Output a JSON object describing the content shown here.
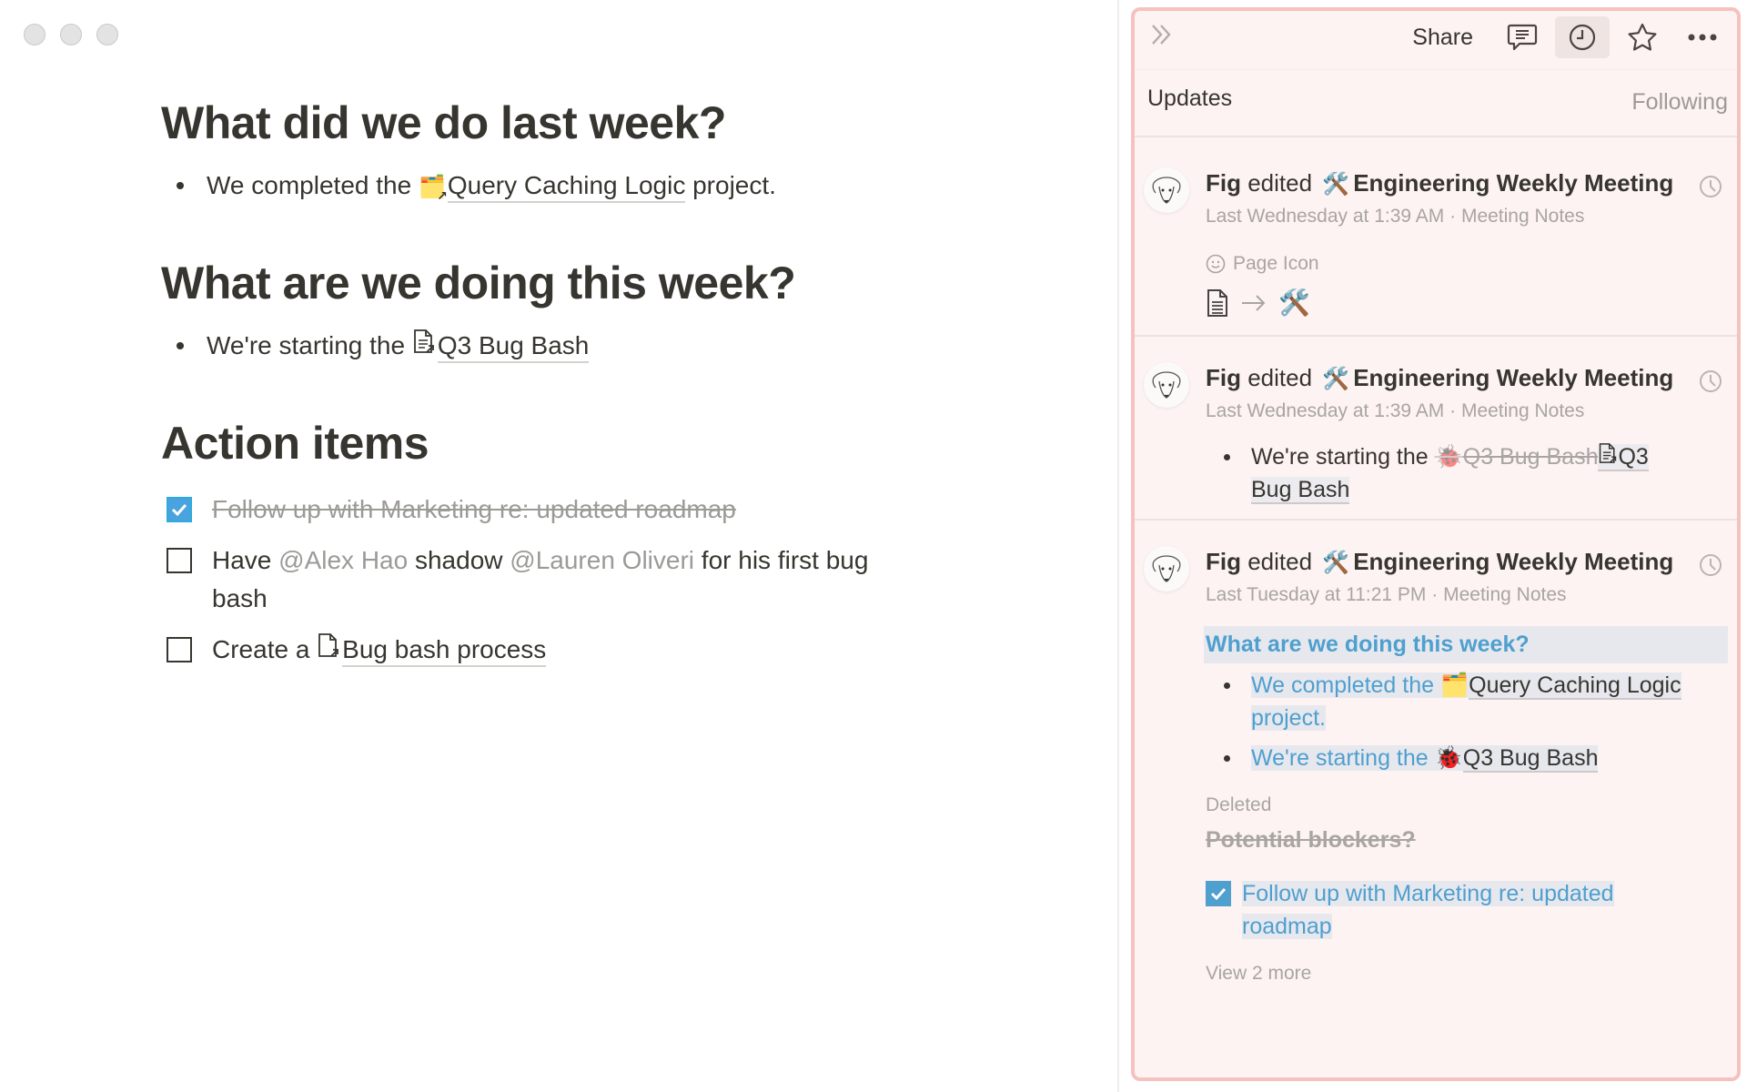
{
  "window": {
    "controls": [
      "close",
      "minimize",
      "zoom"
    ]
  },
  "document": {
    "sections": [
      {
        "heading": "What did we do last week?",
        "bullets": [
          {
            "prefix": "We completed the ",
            "link_icon": "card-index-dividers-icon",
            "link_text": "Query Caching Logic",
            "suffix": " project."
          }
        ]
      },
      {
        "heading": "What are we doing this week?",
        "bullets": [
          {
            "prefix": "We're starting the ",
            "link_icon": "page-icon",
            "link_text": "Q3 Bug Bash",
            "suffix": ""
          }
        ]
      },
      {
        "heading": "Action items",
        "todos": [
          {
            "checked": true,
            "text": "Follow up with Marketing re: updated roadmap"
          },
          {
            "checked": false,
            "parts": [
              "Have ",
              "@Alex Hao",
              " shadow ",
              "@Lauren Oliveri",
              " for his first bug bash"
            ]
          },
          {
            "checked": false,
            "prefix": "Create a ",
            "link_icon": "blank-page-icon",
            "link_text": "Bug bash process"
          }
        ]
      }
    ]
  },
  "panel": {
    "topbar": {
      "collapse_icon": "double-chevron-right-icon",
      "share_label": "Share",
      "icons": [
        "comments-icon",
        "updates-clock-icon",
        "favorite-star-icon",
        "more-icon"
      ],
      "active_icon": "updates-clock-icon"
    },
    "title": "Updates",
    "filter_label": "Following",
    "accent_border": "#f5c2c0",
    "background": "#fdf3f2",
    "updates": [
      {
        "actor": "Fig",
        "verb": " edited ",
        "page_emoji": "🛠️",
        "page": "Engineering Weekly Meeting",
        "time": "Last Wednesday at 1:39 AM",
        "separator": " · ",
        "location": "Meeting Notes",
        "change": {
          "type": "page_icon",
          "label": "Page Icon",
          "from": "document-icon",
          "arrow": "→",
          "to": "🛠️"
        }
      },
      {
        "actor": "Fig",
        "verb": " edited ",
        "page_emoji": "🛠️",
        "page": "Engineering Weekly Meeting",
        "time": "Last Wednesday at 1:39 AM",
        "separator": " · ",
        "location": "Meeting Notes",
        "change": {
          "type": "text",
          "prefix": "We're starting the ",
          "removed_icon": "🐞",
          "removed_text": "Q3 Bug Bash",
          "added_icon": "page-icon",
          "added_text_line1": "Q3",
          "added_text_line2": "Bug Bash"
        }
      },
      {
        "actor": "Fig",
        "verb": " edited ",
        "page_emoji": "🛠️",
        "page": "Engineering Weekly Meeting",
        "time": "Last Tuesday at 11:21 PM",
        "separator": " · ",
        "location": "Meeting Notes",
        "change": {
          "type": "blocks",
          "heading": "What are we doing this week?",
          "bullets": [
            {
              "prefix": "We completed the ",
              "icon": "🗂️",
              "link": "Query Caching Logic",
              "suffix_line2": "project."
            },
            {
              "prefix": "We're starting the ",
              "icon": "🐞",
              "link": "Q3 Bug Bash"
            }
          ],
          "deleted_label": "Deleted",
          "deleted_text": "Potential blockers?",
          "todo": {
            "checked": true,
            "line1": "Follow up with Marketing re: updated",
            "line2": "roadmap"
          },
          "view_more": "View 2 more"
        }
      }
    ]
  }
}
